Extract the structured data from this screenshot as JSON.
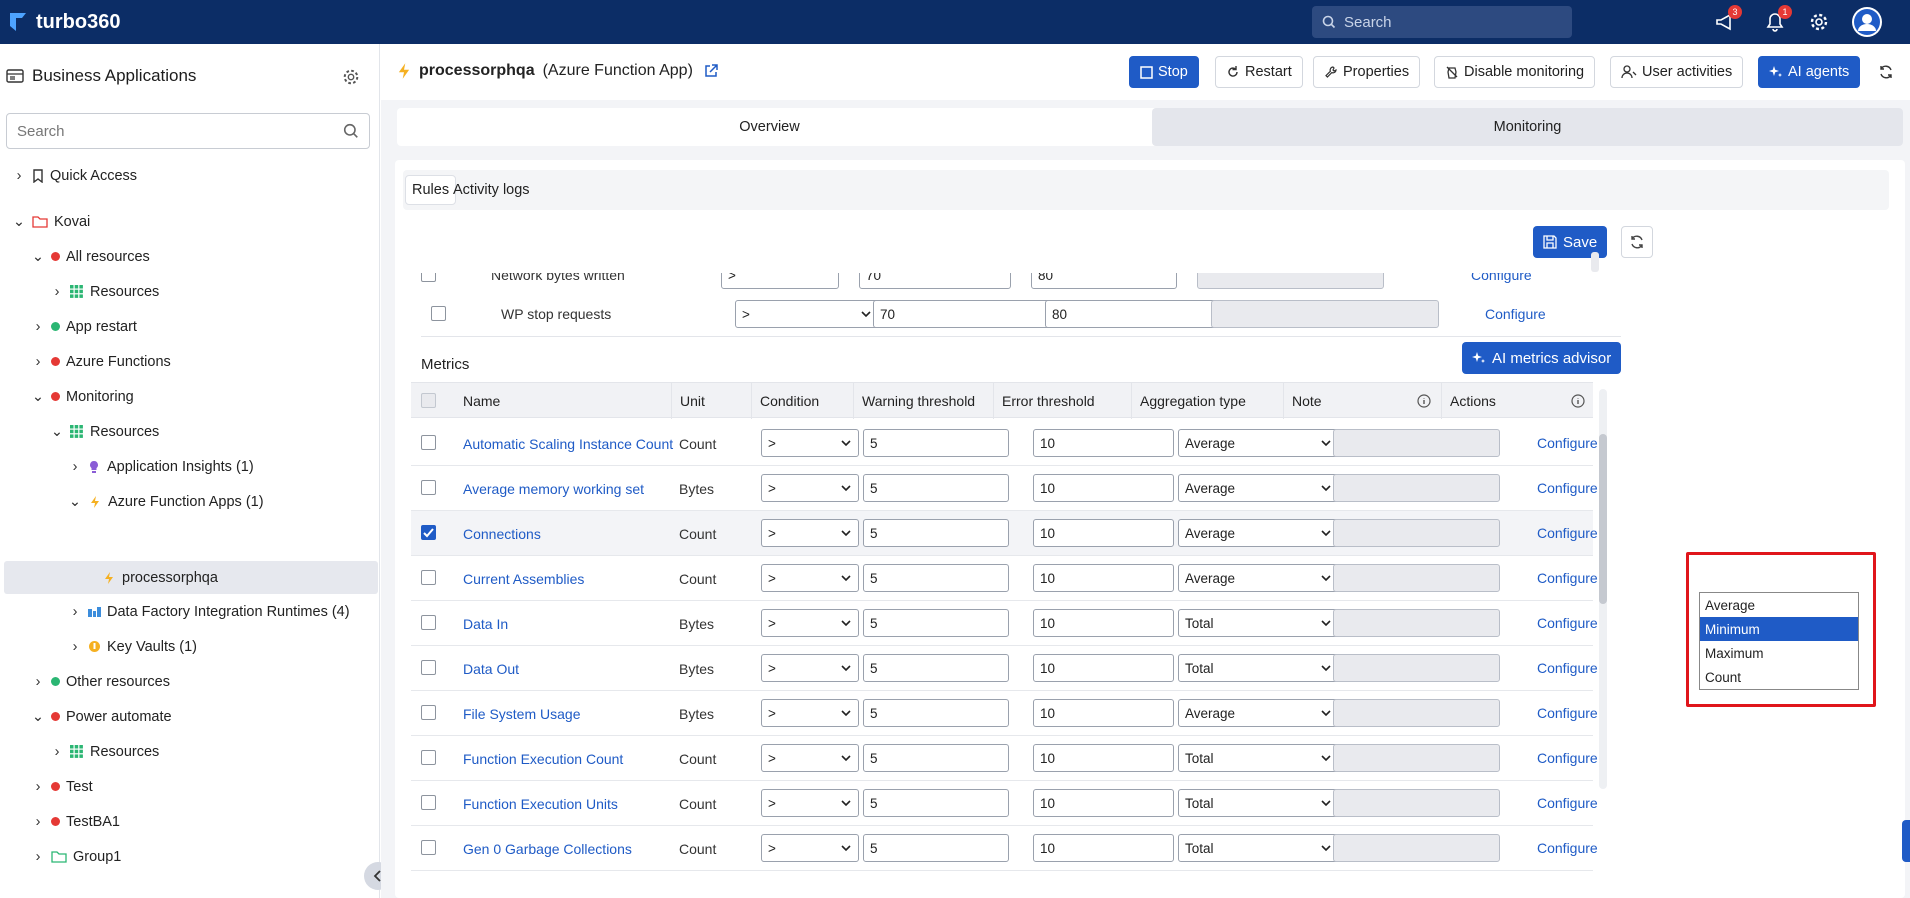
{
  "topbar": {
    "brand": "turbo360",
    "search_placeholder": "Search",
    "notif_count": "3",
    "alert_count": "1"
  },
  "sidebar": {
    "title": "Business Applications",
    "search_placeholder": "Search",
    "tree": [
      {
        "label": "Quick Access"
      },
      {
        "label": "Kovai"
      },
      {
        "label": "All resources"
      },
      {
        "label": "Resources"
      },
      {
        "label": "App restart"
      },
      {
        "label": "Azure Functions"
      },
      {
        "label": "Monitoring"
      },
      {
        "label": "Resources"
      },
      {
        "label": "Application Insights (1)"
      },
      {
        "label": "Azure Function Apps (1)"
      },
      {
        "label": "processorphqa"
      },
      {
        "label": "Data Factory Integration Runtimes (4)"
      },
      {
        "label": "Key Vaults (1)"
      },
      {
        "label": "Other resources"
      },
      {
        "label": "Power automate"
      },
      {
        "label": "Resources"
      },
      {
        "label": "Test"
      },
      {
        "label": "TestBA1"
      },
      {
        "label": "Group1"
      }
    ]
  },
  "header": {
    "resource_name": "processorphqa",
    "resource_type": "(Azure Function App)",
    "buttons": {
      "stop": "Stop",
      "restart": "Restart",
      "properties": "Properties",
      "disable": "Disable monitoring",
      "user_activities": "User activities",
      "ai_agents": "AI agents"
    }
  },
  "tabs": {
    "overview": "Overview",
    "monitoring": "Monitoring"
  },
  "subtabs": {
    "rules": "Rules",
    "activity": "Activity logs"
  },
  "save_label": "Save",
  "status_rows": [
    {
      "name": "Network bytes written",
      "condition": ">",
      "warning": "70",
      "error": "80",
      "action": "Configure"
    },
    {
      "name": "WP stop requests",
      "condition": ">",
      "warning": "70",
      "error": "80",
      "action": "Configure"
    }
  ],
  "metrics": {
    "title": "Metrics",
    "advisor_label": "AI metrics advisor",
    "columns": [
      "Name",
      "Unit",
      "Condition",
      "Warning threshold",
      "Error threshold",
      "Aggregation type",
      "Note",
      "Actions"
    ],
    "rows": [
      {
        "name": "Automatic Scaling Instance Count",
        "unit": "Count",
        "condition": ">",
        "warning": "5",
        "error": "10",
        "aggregation": "Average",
        "action": "Configure",
        "checked": false
      },
      {
        "name": "Average memory working set",
        "unit": "Bytes",
        "condition": ">",
        "warning": "5",
        "error": "10",
        "aggregation": "Average",
        "action": "Configure",
        "checked": false
      },
      {
        "name": "Connections",
        "unit": "Count",
        "condition": ">",
        "warning": "5",
        "error": "10",
        "aggregation": "Average",
        "action": "Configure",
        "checked": true
      },
      {
        "name": "Current Assemblies",
        "unit": "Count",
        "condition": ">",
        "warning": "5",
        "error": "10",
        "aggregation": "Average",
        "action": "Configure",
        "checked": false
      },
      {
        "name": "Data In",
        "unit": "Bytes",
        "condition": ">",
        "warning": "5",
        "error": "10",
        "aggregation": "Total",
        "action": "Configure",
        "checked": false
      },
      {
        "name": "Data Out",
        "unit": "Bytes",
        "condition": ">",
        "warning": "5",
        "error": "10",
        "aggregation": "Total",
        "action": "Configure",
        "checked": false
      },
      {
        "name": "File System Usage",
        "unit": "Bytes",
        "condition": ">",
        "warning": "5",
        "error": "10",
        "aggregation": "Average",
        "action": "Configure",
        "checked": false
      },
      {
        "name": "Function Execution Count",
        "unit": "Count",
        "condition": ">",
        "warning": "5",
        "error": "10",
        "aggregation": "Total",
        "action": "Configure",
        "checked": false
      },
      {
        "name": "Function Execution Units",
        "unit": "Count",
        "condition": ">",
        "warning": "5",
        "error": "10",
        "aggregation": "Total",
        "action": "Configure",
        "checked": false
      },
      {
        "name": "Gen 0 Garbage Collections",
        "unit": "Count",
        "condition": ">",
        "warning": "5",
        "error": "10",
        "aggregation": "Total",
        "action": "Configure",
        "checked": false
      }
    ]
  },
  "dropdown_options": [
    "Average",
    "Minimum",
    "Maximum",
    "Count"
  ],
  "dropdown_highlighted": "Minimum"
}
